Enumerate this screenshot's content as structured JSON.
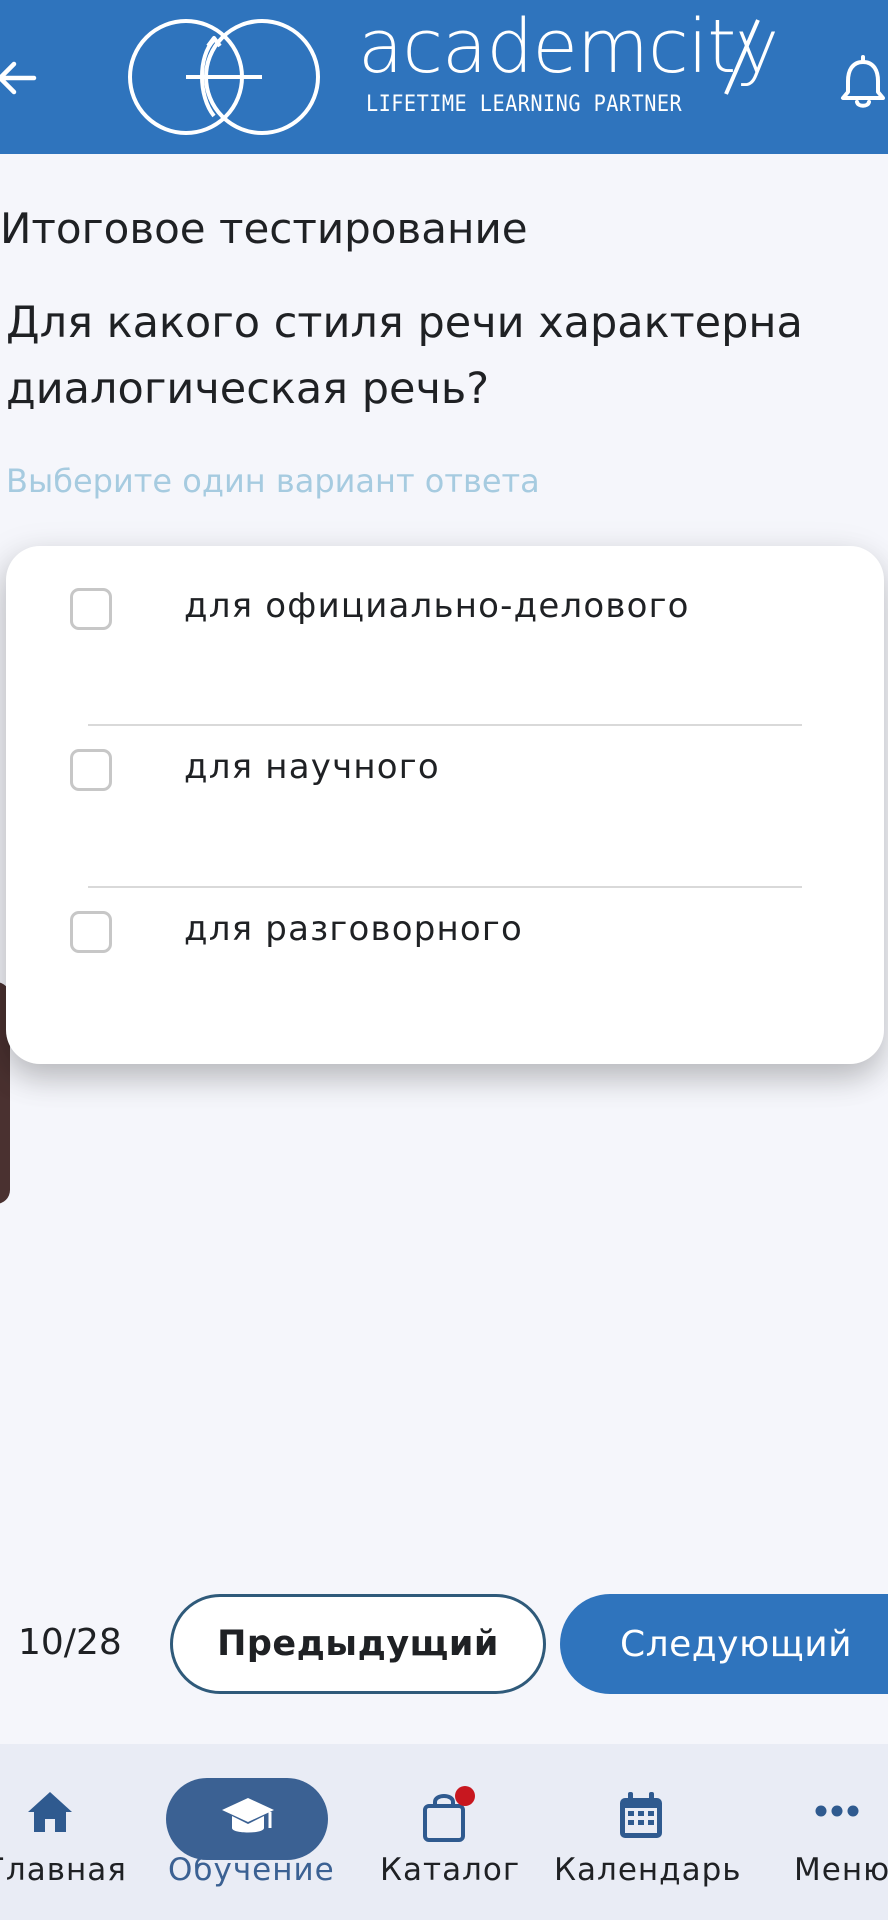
{
  "header": {
    "brand_name": "academcity",
    "brand_tagline": "LIFETIME LEARNING PARTNER",
    "back_icon": "arrow-left-icon",
    "bell_icon": "bell-icon",
    "background_color": "#2f74bd"
  },
  "quiz": {
    "title": "Итоговое тестирование",
    "question": "Для какого стиля речи характерна диалогическая речь?",
    "hint": "Выберите один вариант ответа",
    "options": [
      {
        "label": "для официально-делового",
        "checked": false
      },
      {
        "label": "для научного",
        "checked": false
      },
      {
        "label": "для разговорного",
        "checked": false
      }
    ]
  },
  "pager": {
    "counter": "10/28",
    "prev_label": "Предыдущий",
    "next_label": "Следующий"
  },
  "tabbar": {
    "active": "Обучение",
    "items": [
      {
        "label": "Главная",
        "icon": "home-icon"
      },
      {
        "label": "Обучение",
        "icon": "graduation-cap-icon"
      },
      {
        "label": "Каталог",
        "icon": "shopping-bag-icon",
        "badge": true
      },
      {
        "label": "Календарь",
        "icon": "calendar-icon"
      },
      {
        "label": "Меню",
        "icon": "more-dots-icon"
      }
    ]
  },
  "colors": {
    "accent": "#2f74bd",
    "hint": "#a6cbe0",
    "active_tab": "#3b6193",
    "badge": "#c8171f"
  }
}
